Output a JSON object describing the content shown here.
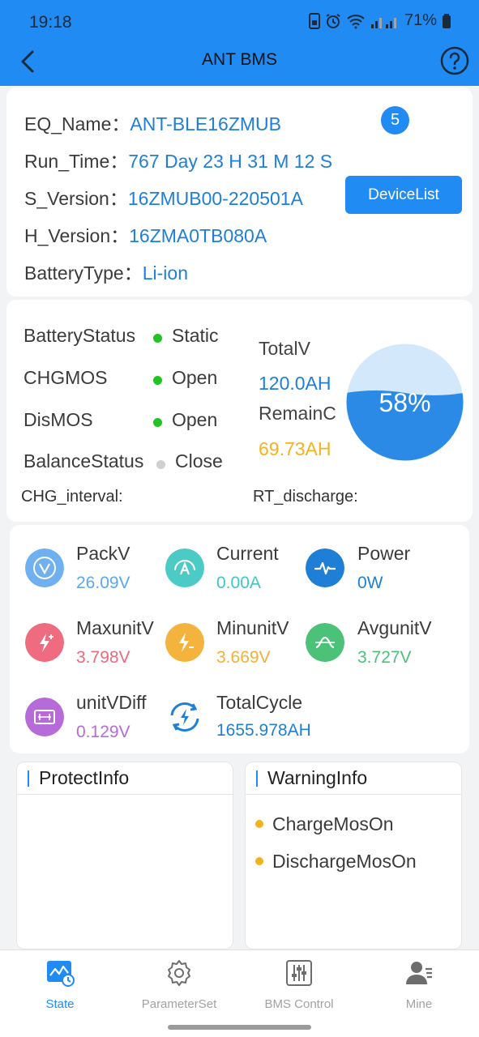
{
  "status_bar": {
    "time": "19:18",
    "battery": "71%"
  },
  "header": {
    "title": "ANT BMS"
  },
  "device": {
    "fields": [
      {
        "label": "EQ_Name：",
        "value": "ANT-BLE16ZMUB"
      },
      {
        "label": "Run_Time：",
        "value": "767 Day 23 H 31 M 12 S"
      },
      {
        "label": "S_Version：",
        "value": "16ZMUB00-220501A"
      },
      {
        "label": "H_Version：",
        "value": "16ZMA0TB080A"
      },
      {
        "label": "BatteryType：",
        "value": "Li-ion"
      }
    ],
    "badge_count": "5",
    "device_list_label": "DeviceList"
  },
  "status": {
    "items": [
      {
        "label": "BatteryStatus",
        "value": "Static",
        "color": "#22c322"
      },
      {
        "label": "CHGMOS",
        "value": "Open",
        "color": "#22c322"
      },
      {
        "label": "DisMOS",
        "value": "Open",
        "color": "#22c322"
      },
      {
        "label": "BalanceStatus",
        "value": "Close",
        "color": "#d0d0d0"
      }
    ],
    "chg_interval_label": "CHG_interval:",
    "rt_discharge_label": "RT_discharge:",
    "total_label": "TotalV",
    "total_value": "120.0AH",
    "remain_label": "RemainC",
    "remain_value": "69.73AH",
    "soc_text": "58%",
    "soc_fraction": 0.58
  },
  "metrics": [
    {
      "label": "PackV",
      "value": "26.09V",
      "color": "#5aa8ee",
      "icon": "packv-icon"
    },
    {
      "label": "Current",
      "value": "0.00A",
      "color": "#3fc7c3",
      "icon": "current-icon"
    },
    {
      "label": "Power",
      "value": "0W",
      "color": "#1f7fd6",
      "icon": "power-icon"
    },
    {
      "label": "MaxunitV",
      "value": "3.798V",
      "color": "#ec6a7e",
      "icon": "maxunitv-icon"
    },
    {
      "label": "MinunitV",
      "value": "3.669V",
      "color": "#f2b136",
      "icon": "minunitv-icon"
    },
    {
      "label": "AvgunitV",
      "value": "3.727V",
      "color": "#4cc178",
      "icon": "avgunitv-icon"
    },
    {
      "label": "unitVDiff",
      "value": "0.129V",
      "color": "#b66bd8",
      "icon": "unitvdiff-icon"
    },
    {
      "label": "TotalCycle",
      "value": "1655.978AH",
      "color": "#1f7fd6",
      "icon": "totalcycle-icon"
    }
  ],
  "protect": {
    "title": "ProtectInfo",
    "items": []
  },
  "warning": {
    "title": "WarningInfo",
    "items": [
      "ChargeMosOn",
      "DischargeMosOn"
    ]
  },
  "nav": [
    {
      "label": "State",
      "active": true
    },
    {
      "label": "ParameterSet",
      "active": false
    },
    {
      "label": "BMS Control",
      "active": false
    },
    {
      "label": "Mine",
      "active": false
    }
  ]
}
